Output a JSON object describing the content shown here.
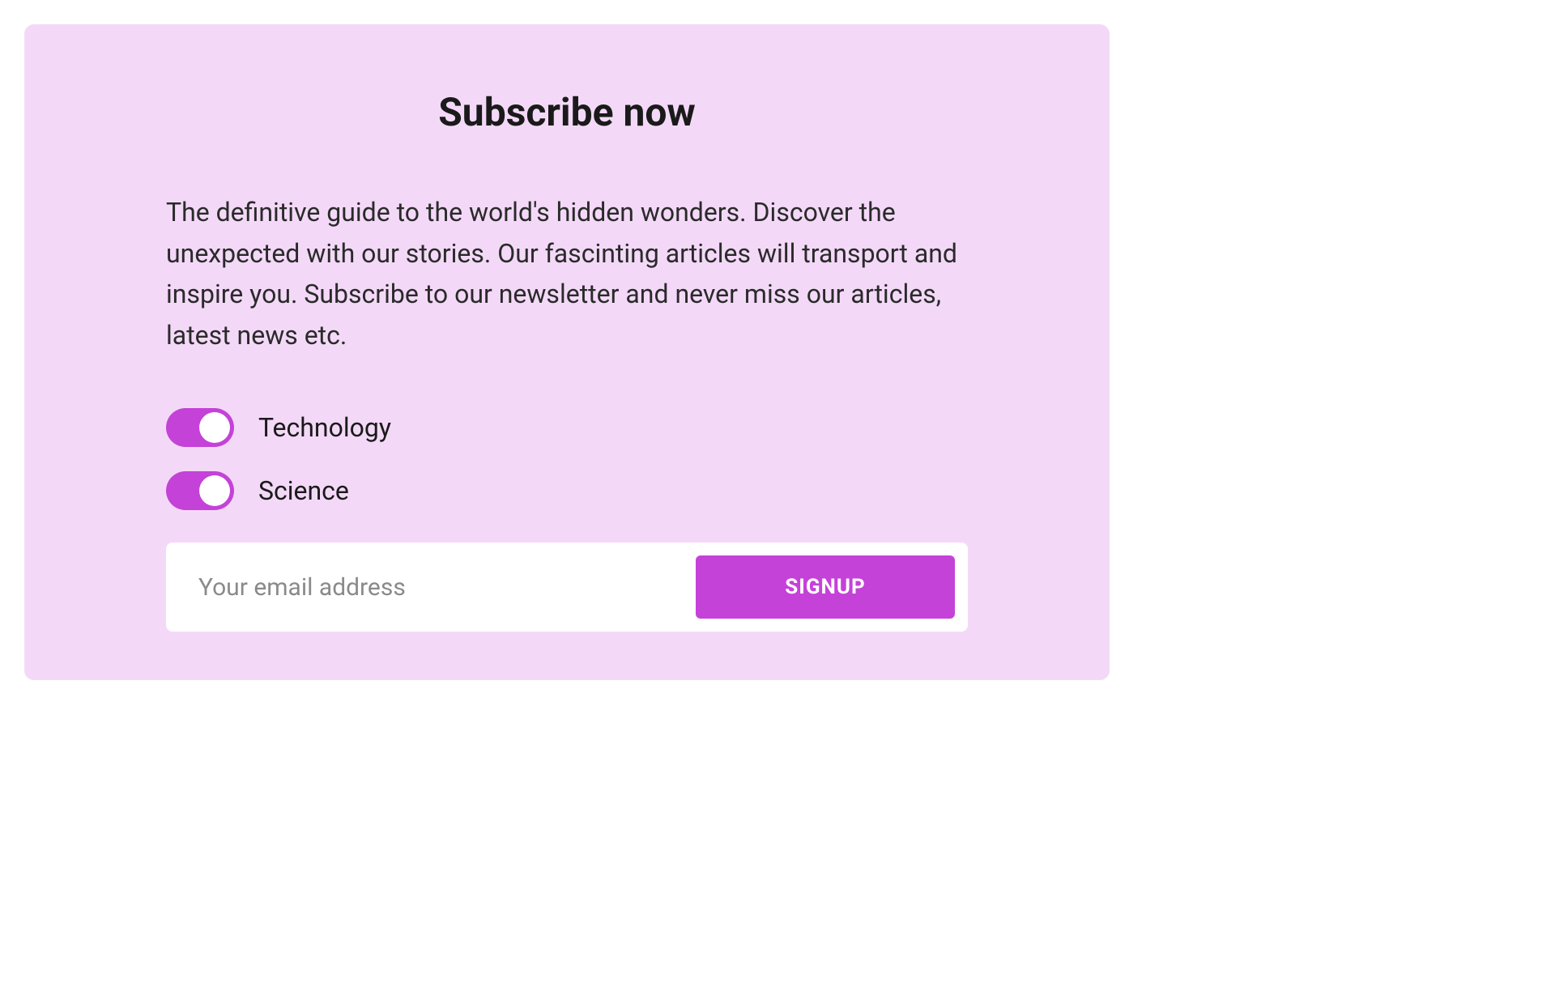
{
  "card": {
    "title": "Subscribe now",
    "description": "The definitive guide to the world's hidden wonders. Discover the unexpected with our stories. Our fascinting articles will transport and inspire you. Subscribe to our newsletter and never miss our articles, latest news etc.",
    "toggles": [
      {
        "label": "Technology",
        "checked": true
      },
      {
        "label": "Science",
        "checked": true
      }
    ],
    "email": {
      "placeholder": "Your email address",
      "value": ""
    },
    "signup_label": "SIGNUP"
  },
  "colors": {
    "card_bg": "#f3d9f7",
    "accent": "#c442d8"
  }
}
